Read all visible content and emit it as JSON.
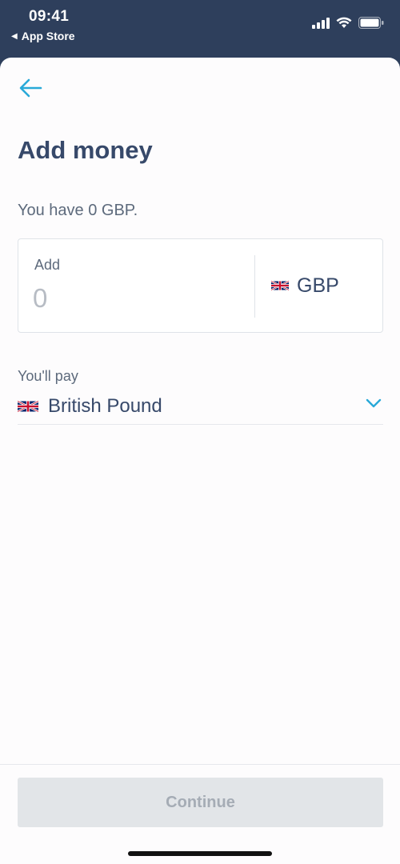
{
  "status_bar": {
    "time": "09:41",
    "back_app": "App Store",
    "icons": [
      "cellular-signal-icon",
      "wifi-icon",
      "battery-icon"
    ]
  },
  "header": {
    "back_icon": "back-arrow-icon",
    "title": "Add money"
  },
  "balance_text": "You have 0 GBP.",
  "amount": {
    "label": "Add",
    "value": "",
    "placeholder": "0",
    "currency_code": "GBP",
    "currency_flag": "uk-flag-icon"
  },
  "pay": {
    "label": "You'll pay",
    "currency_name": "British Pound",
    "currency_flag": "uk-flag-icon",
    "chevron": "chevron-down-icon"
  },
  "footer": {
    "continue_label": "Continue"
  },
  "colors": {
    "status_bar_bg": "#2e3f5c",
    "accent": "#29a9d8",
    "title": "#37496a",
    "disabled_button_bg": "#e2e5e8",
    "disabled_button_text": "#a5acb5"
  }
}
